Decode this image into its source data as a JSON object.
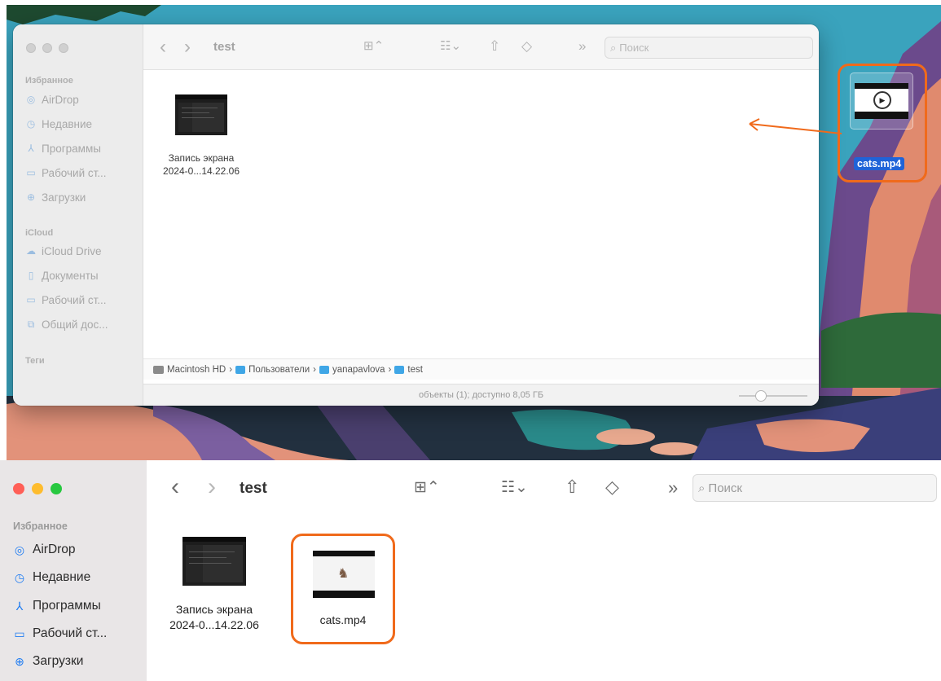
{
  "top_finder": {
    "window_title": "test",
    "nav_back": "‹",
    "nav_forward": "›",
    "more": "»",
    "search_placeholder": "Поиск",
    "sidebar": {
      "favorites_header": "Избранное",
      "favorites": [
        {
          "label": "AirDrop",
          "icon": "airdrop-icon"
        },
        {
          "label": "Недавние",
          "icon": "clock-icon"
        },
        {
          "label": "Программы",
          "icon": "apps-icon"
        },
        {
          "label": "Рабочий ст...",
          "icon": "desktop-icon"
        },
        {
          "label": "Загрузки",
          "icon": "download-icon"
        }
      ],
      "icloud_header": "iCloud",
      "icloud": [
        {
          "label": "iCloud Drive",
          "icon": "cloud-icon"
        },
        {
          "label": "Документы",
          "icon": "document-icon"
        },
        {
          "label": "Рабочий ст...",
          "icon": "desktop-icon"
        },
        {
          "label": "Общий дос...",
          "icon": "shared-folder-icon"
        }
      ],
      "tags_header": "Теги"
    },
    "files": [
      {
        "name_line1": "Запись экрана",
        "name_line2": "2024-0...14.22.06"
      }
    ],
    "path": [
      "Macintosh HD",
      "Пользователи",
      "yanapavlova",
      "test"
    ],
    "path_separator": "›",
    "status": "объекты (1); доступно 8,05 ГБ"
  },
  "dragged_file": {
    "label": "cats.mp4"
  },
  "bottom_finder": {
    "window_title": "test",
    "nav_back": "‹",
    "nav_forward": "›",
    "more": "»",
    "search_placeholder": "Поиск",
    "sidebar": {
      "favorites_header": "Избранное",
      "favorites": [
        {
          "label": "AirDrop",
          "icon": "airdrop-icon"
        },
        {
          "label": "Недавние",
          "icon": "clock-icon"
        },
        {
          "label": "Программы",
          "icon": "apps-icon"
        },
        {
          "label": "Рабочий ст...",
          "icon": "desktop-icon"
        },
        {
          "label": "Загрузки",
          "icon": "download-icon"
        }
      ]
    },
    "files": [
      {
        "name_line1": "Запись экрана",
        "name_line2": "2024-0...14.22.06"
      },
      {
        "name_line1": "cats.mp4",
        "name_line2": ""
      }
    ]
  },
  "colors": {
    "highlight": "#f06a1b",
    "selection": "#1f63d8",
    "folder": "#3fa6e6",
    "sidebar_icon": "#1e7cf2",
    "traffic_red": "#ff5f57",
    "traffic_yellow": "#febc2e",
    "traffic_green": "#28c840"
  }
}
